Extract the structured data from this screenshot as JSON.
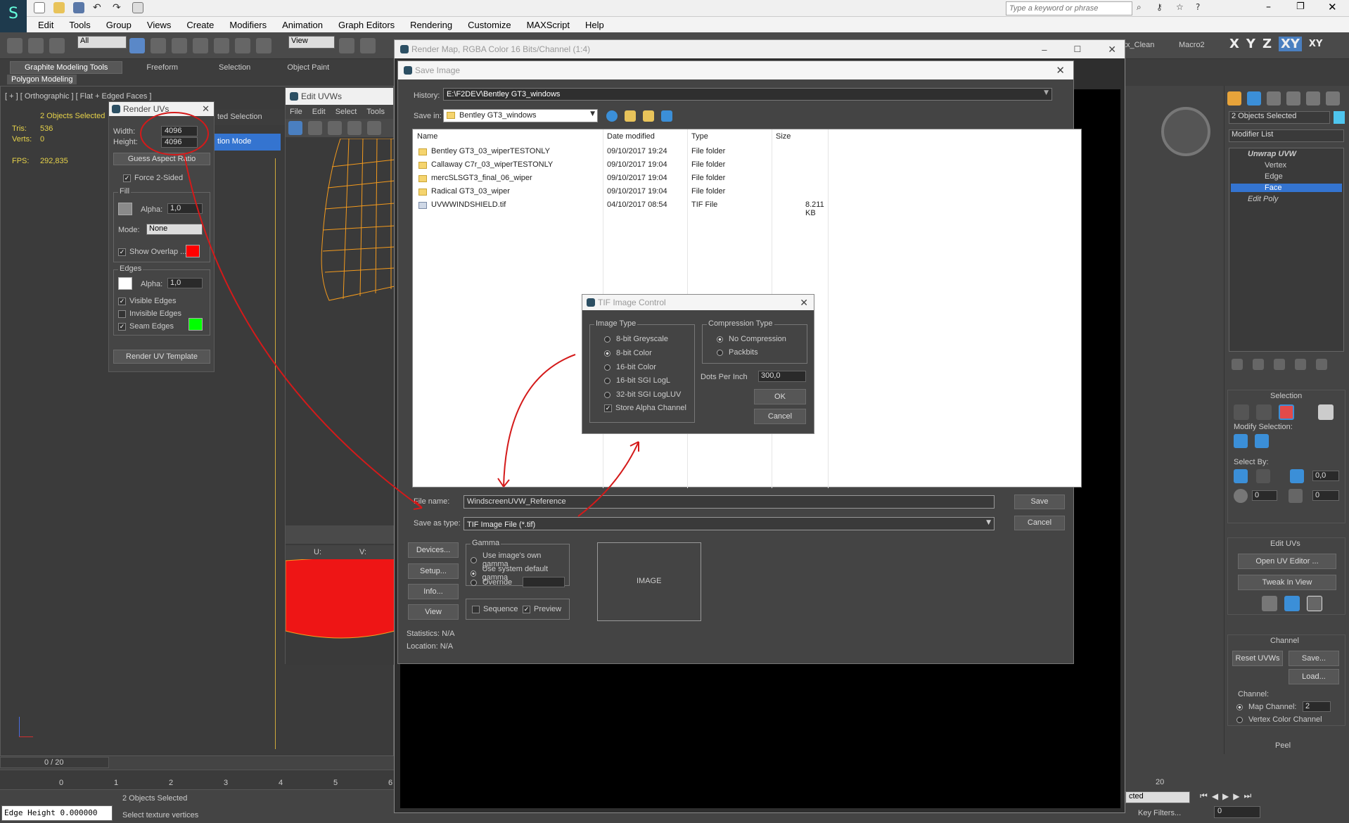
{
  "app": {
    "search_placeholder": "Type a keyword or phrase",
    "menu": [
      "Edit",
      "Tools",
      "Group",
      "Views",
      "Create",
      "Modifiers",
      "Animation",
      "Graph Editors",
      "Rendering",
      "Customize",
      "MAXScript",
      "Help"
    ],
    "selection_filter": "All",
    "view_dropdown": "View",
    "toolbar_right": {
      "labels": [
        "tx_Clean",
        "Macro2"
      ],
      "axes": [
        "X",
        "Y",
        "Z",
        "XY",
        "XY"
      ]
    },
    "ribbon_tabs": [
      "Graphite Modeling Tools",
      "Freeform",
      "Selection",
      "Object Paint"
    ],
    "ribbon_subtab": "Polygon Modeling",
    "viewport_label": "[ + ] [ Orthographic ] [ Flat + Edged Faces ]",
    "stats": {
      "selected": "2 Objects Selected",
      "tris_label": "Tris:",
      "tris": "536",
      "verts_label": "Verts:",
      "verts": "0",
      "fps_label": "FPS:",
      "fps": "292,835"
    },
    "timeline": {
      "frame": "0 / 20",
      "ticks": [
        "0",
        "1",
        "2",
        "3",
        "4",
        "5",
        "6"
      ],
      "end_tick": "20"
    },
    "status": {
      "selected": "2 Objects Selected",
      "prompt": "Select texture vertices",
      "edge_height": "Edge Height 0.000000",
      "key_filters": "Key Filters...",
      "frame_field": "0",
      "selected_dd": "cted"
    }
  },
  "render_uvs": {
    "title": "Render UVs",
    "width_label": "Width:",
    "width": "4096",
    "height_label": "Height:",
    "height": "4096",
    "guess_btn": "Guess Aspect Ratio",
    "force2": "Force 2-Sided",
    "fill_group": "Fill",
    "alpha_label": "Alpha:",
    "fill_alpha": "1,0",
    "mode_label": "Mode:",
    "mode": "None",
    "show_overlap": "Show Overlap ...",
    "edges_group": "Edges",
    "edges_alpha": "1,0",
    "visible_edges": "Visible Edges",
    "invisible_edges": "Invisible Edges",
    "seam_edges": "Seam Edges",
    "render_btn": "Render UV Template",
    "fill_color": "#8a8a8a",
    "overlap_color": "#ff0000",
    "edge_color": "#ffffff",
    "seam_color": "#00ff00"
  },
  "edit_uvs": {
    "title": "Edit UVWs",
    "menu": [
      "File",
      "Edit",
      "Select",
      "Tools"
    ],
    "ghost_tab": "ted Selection",
    "mode_btn": "tion Mode",
    "u_label": "U:",
    "v_label": "V:"
  },
  "render_map": {
    "title": "Render Map, RGBA Color 16 Bits/Channel (1:4)"
  },
  "save_image": {
    "title": "Save Image",
    "history_label": "History:",
    "history": "E:\\F2DEV\\Bentley GT3_windows",
    "savein_label": "Save in:",
    "savein": "Bentley GT3_windows",
    "columns": [
      "Name",
      "Date modified",
      "Type",
      "Size"
    ],
    "files": [
      {
        "name": "Bentley GT3_03_wiperTESTONLY",
        "date": "09/10/2017 19:24",
        "type": "File folder",
        "size": ""
      },
      {
        "name": "Callaway C7r_03_wiperTESTONLY",
        "date": "09/10/2017 19:04",
        "type": "File folder",
        "size": ""
      },
      {
        "name": "mercSLSGT3_final_06_wiper",
        "date": "09/10/2017 19:04",
        "type": "File folder",
        "size": ""
      },
      {
        "name": "Radical GT3_03_wiper",
        "date": "09/10/2017 19:04",
        "type": "File folder",
        "size": ""
      },
      {
        "name": "UVWWINDSHIELD.tif",
        "date": "04/10/2017 08:54",
        "type": "TIF File",
        "size": "8.211 KB"
      }
    ],
    "filename_label": "File name:",
    "filename": "WindscreenUVW_Reference",
    "saveas_label": "Save as type:",
    "saveas": "TIF Image File (*.tif)",
    "save_btn": "Save",
    "cancel_btn": "Cancel",
    "devices_btn": "Devices...",
    "setup_btn": "Setup...",
    "info_btn": "Info...",
    "view_btn": "View",
    "gamma_group": "Gamma",
    "gamma_options": [
      "Use image's own gamma",
      "Use system default gamma",
      "Override"
    ],
    "sequence": "Sequence",
    "preview": "Preview",
    "image_box": "IMAGE",
    "statistics": "Statistics:  N/A",
    "location": "Location:  N/A"
  },
  "tif_control": {
    "title": "TIF Image Control",
    "image_type_label": "Image Type",
    "image_types": [
      "8-bit Greyscale",
      "8-bit Color",
      "16-bit Color",
      "16-bit SGI LogL",
      "32-bit SGI LogLUV"
    ],
    "store_alpha": "Store Alpha Channel",
    "compression_label": "Compression Type",
    "compression": [
      "No Compression",
      "Packbits"
    ],
    "dpi_label": "Dots Per Inch",
    "dpi": "300,0",
    "ok": "OK",
    "cancel": "Cancel"
  },
  "cmd_panel": {
    "selected": "2 Objects Selected",
    "modifier_list": "Modifier List",
    "stack": [
      "Unwrap UVW",
      "Vertex",
      "Edge",
      "Face",
      "Edit Poly"
    ],
    "selection_title": "Selection",
    "modify_selection": "Modify Selection:",
    "select_by": "Select By:",
    "spin1": "0,0",
    "spin2": "0",
    "spin3": "0",
    "edit_uvs_title": "Edit UVs",
    "open_uv": "Open UV Editor ...",
    "tweak": "Tweak In View",
    "channel_title": "Channel",
    "reset_uvws": "Reset UVWs",
    "save": "Save...",
    "load": "Load...",
    "channel_label": "Channel:",
    "map_channel": "Map Channel:",
    "map_channel_val": "2",
    "vertex_color": "Vertex Color Channel",
    "peel_title": "Peel"
  }
}
